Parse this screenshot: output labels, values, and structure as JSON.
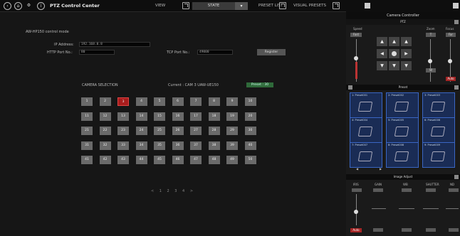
{
  "header": {
    "app_title": "PTZ Control Center",
    "tabs": [
      {
        "label": "VIEW"
      },
      {
        "label": "STATE"
      },
      {
        "label": "PRESET LIST"
      },
      {
        "label": "VISUAL PRESETS"
      }
    ]
  },
  "main": {
    "camera_mode": "AW-HP150 control mode",
    "ip_label": "IP Address:",
    "ip_value": "192.168.0.8",
    "http_label": "HTTP Port No.:",
    "http_value": "80",
    "tcp_label": "TCP Port No.:",
    "tcp_value": "49000",
    "register_label": "Register",
    "camera_selection_label": "CAMERA SELECTION",
    "current_label": "Current : CAM 3  UAW-UE150",
    "preset_badge": "Preset : 30",
    "cameras": [
      [
        "1",
        "2",
        "3",
        "4",
        "5",
        "6",
        "7",
        "8",
        "9",
        "10"
      ],
      [
        "11",
        "12",
        "13",
        "14",
        "15",
        "16",
        "17",
        "18",
        "19",
        "20"
      ],
      [
        "21",
        "22",
        "23",
        "24",
        "25",
        "26",
        "27",
        "28",
        "29",
        "30"
      ],
      [
        "31",
        "32",
        "33",
        "34",
        "35",
        "36",
        "37",
        "38",
        "39",
        "40"
      ],
      [
        "41",
        "42",
        "43",
        "44",
        "45",
        "46",
        "47",
        "48",
        "49",
        "50"
      ]
    ],
    "selected_camera": "3",
    "pager": "< 1 2 3 4 >"
  },
  "right_panel": {
    "title": "Camera Controller",
    "ptz_title": "PTZ",
    "speed_label": "Speed",
    "zoom_label": "Zoom",
    "focus_label": "Focus",
    "fast_label": "Fast",
    "slow_label": "Slow",
    "auto_label": "Auto",
    "preset_title": "Preset",
    "presets": [
      {
        "label": "1: Preset001"
      },
      {
        "label": "2: Preset002"
      },
      {
        "label": "3: Preset003"
      },
      {
        "label": "4: Preset004"
      },
      {
        "label": "5: Preset005"
      },
      {
        "label": "6: Preset006"
      },
      {
        "label": "7: Preset007"
      },
      {
        "label": "8: Preset008"
      },
      {
        "label": "9: Preset009"
      }
    ],
    "preset_nav": [
      "◀",
      "▶"
    ],
    "image_adjust_title": "Image Adjust",
    "iris_label": "IRIS",
    "gain_label": "GAIN",
    "wb_label": "WB",
    "shutter_label": "SHUTTER",
    "nd_label": "ND"
  },
  "colors": {
    "selected_camera": "#a81d1d",
    "preset_badge": "#2f6a3a",
    "preset_cell": "#1a2c55",
    "auto_button": "#a52525"
  }
}
